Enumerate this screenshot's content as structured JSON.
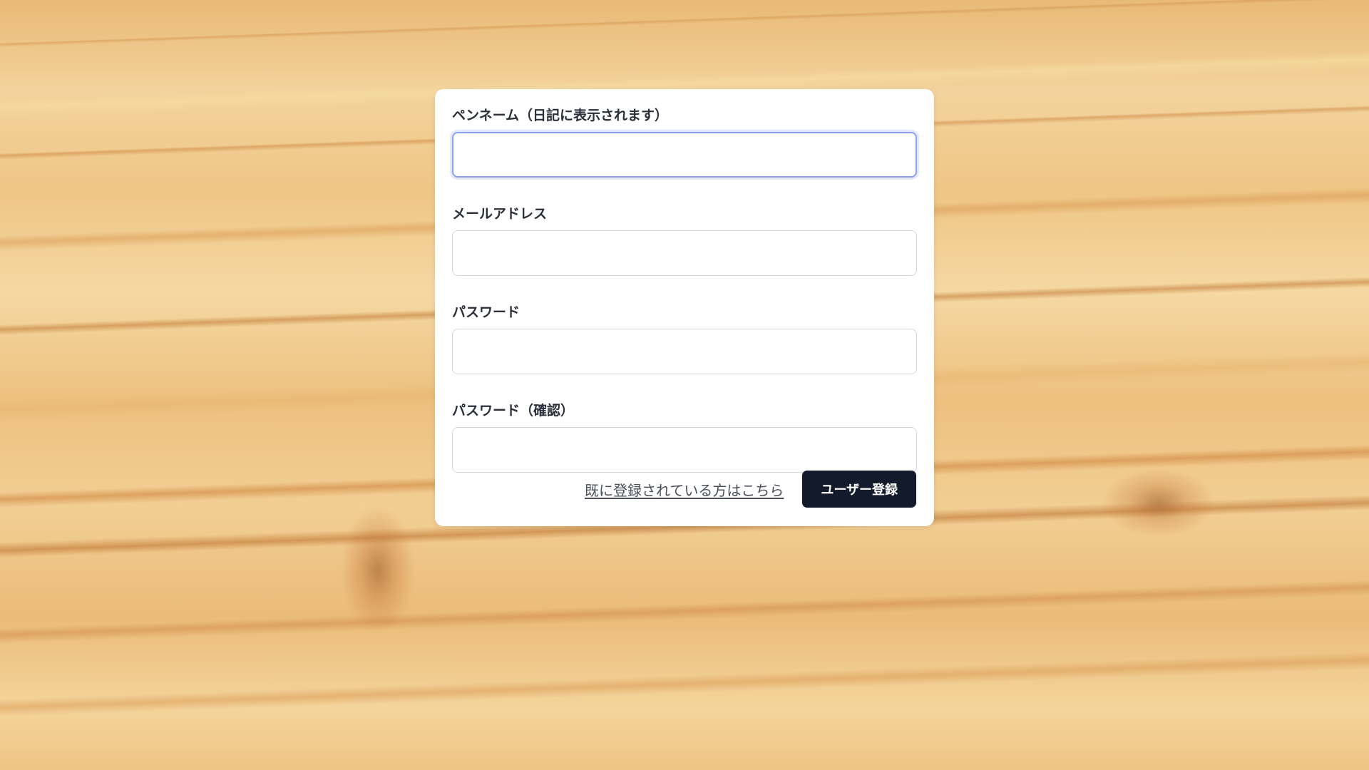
{
  "form": {
    "fields": [
      {
        "label": "ペンネーム（日記に表示されます）",
        "value": "",
        "placeholder": ""
      },
      {
        "label": "メールアドレス",
        "value": "",
        "placeholder": ""
      },
      {
        "label": "パスワード",
        "value": "",
        "placeholder": ""
      },
      {
        "label": "パスワード（確認）",
        "value": "",
        "placeholder": ""
      }
    ],
    "login_link": "既に登録されている方はこちら",
    "register_button": "ユーザー登録"
  },
  "colors": {
    "button_bg": "#131a2b",
    "focus_border": "#8ea0ec",
    "card_bg": "#ffffff"
  }
}
